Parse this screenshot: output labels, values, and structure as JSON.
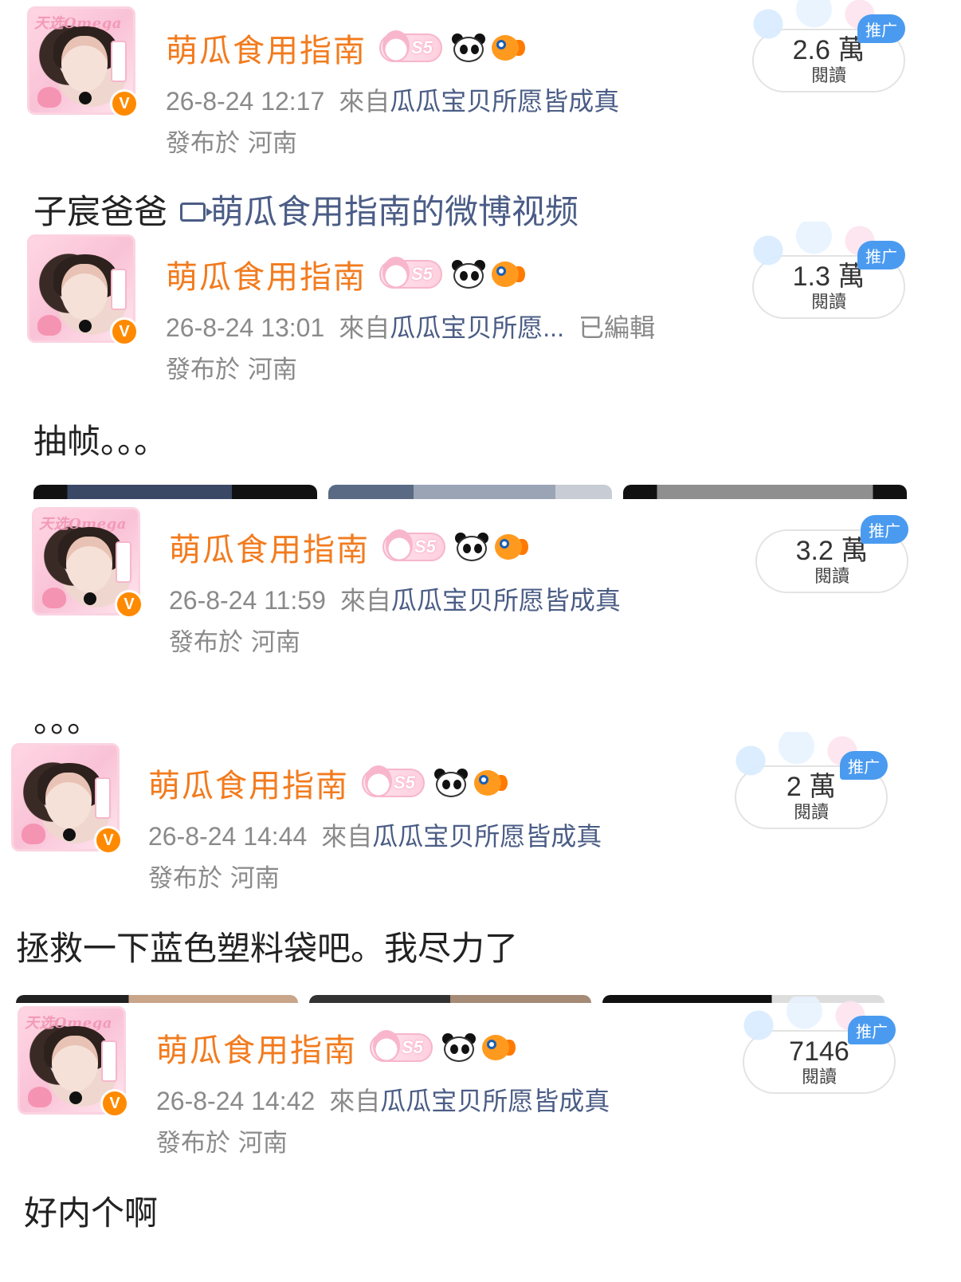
{
  "posts": [
    {
      "author": "萌瓜食用指南",
      "level": "S5",
      "time": "26-8-24 12:17",
      "source_prefix": "來自",
      "source": "瓜瓜宝贝所愿皆成真",
      "edited": "",
      "location": "發布於 河南",
      "reads": "2.6 萬",
      "reads_label": "閱讀",
      "promo": "推广",
      "text": "子宸爸爸",
      "video_link": "萌瓜食用指南的微博视频"
    },
    {
      "author": "萌瓜食用指南",
      "level": "S5",
      "time": "26-8-24 13:01",
      "source_prefix": "來自",
      "source": "瓜瓜宝贝所愿...",
      "edited": "已編輯",
      "location": "發布於 河南",
      "reads": "1.3 萬",
      "reads_label": "閱讀",
      "promo": "推广",
      "text": "抽帧。。。"
    },
    {
      "author": "萌瓜食用指南",
      "level": "S5",
      "time": "26-8-24 11:59",
      "source_prefix": "來自",
      "source": "瓜瓜宝贝所愿皆成真",
      "edited": "",
      "location": "發布於 河南",
      "reads": "3.2 萬",
      "reads_label": "閱讀",
      "promo": "推广",
      "text": "。。。"
    },
    {
      "author": "萌瓜食用指南",
      "level": "S5",
      "time": "26-8-24 14:44",
      "source_prefix": "來自",
      "source": "瓜瓜宝贝所愿皆成真",
      "edited": "",
      "location": "發布於 河南",
      "reads": "2 萬",
      "reads_label": "閱讀",
      "promo": "推广",
      "text": "拯救一下蓝色塑料袋吧。我尽力了"
    },
    {
      "author": "萌瓜食用指南",
      "level": "S5",
      "time": "26-8-24 14:42",
      "source_prefix": "來自",
      "source": "瓜瓜宝贝所愿皆成真",
      "edited": "",
      "location": "發布於 河南",
      "reads": "7146",
      "reads_label": "閱讀",
      "promo": "推广",
      "text": "好内个啊"
    }
  ],
  "icons": {
    "verified": "verified-v-icon",
    "panda": "panda-icon",
    "fish": "fish-icon",
    "video": "video-icon"
  },
  "avatar_banner": "天选Omega",
  "verified_mark": "V",
  "colors": {
    "author": "#f27b1e",
    "source_link": "#4b5d86",
    "meta": "#8a8a8a",
    "promo": "#4a9bf0",
    "verified": "#ff8a00"
  }
}
